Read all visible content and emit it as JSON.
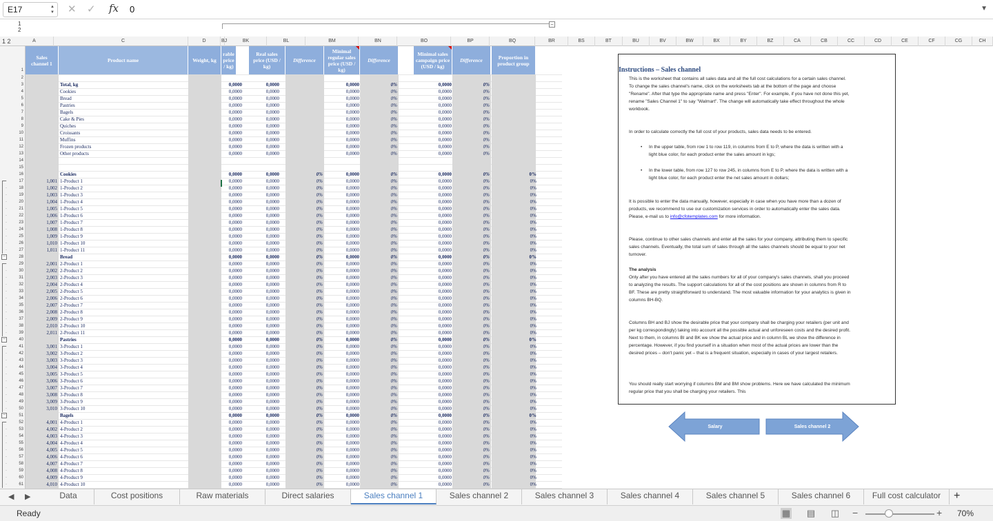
{
  "formula_bar": {
    "cell_ref": "E17",
    "value": "0",
    "fx": "fx",
    "cancel": "✕",
    "ok": "✓",
    "expand": "▼"
  },
  "grouping": {
    "levels": [
      "1",
      "2"
    ],
    "col_levels": "1 2",
    "minus": "−"
  },
  "col_headers": [
    [
      "A",
      22,
      56
    ],
    [
      "C",
      85,
      188
    ],
    [
      "D",
      273,
      47
    ],
    [
      "BJ",
      321,
      5
    ],
    [
      "BK",
      327,
      60
    ],
    [
      "BL",
      388,
      55
    ],
    [
      "BM",
      444,
      76
    ],
    [
      "BN",
      521,
      55
    ],
    [
      "BO",
      577,
      77
    ],
    [
      "BP",
      655,
      55
    ],
    [
      "BQ",
      711,
      65
    ],
    [
      "BR",
      777,
      47
    ],
    [
      "BS",
      824,
      39
    ],
    [
      "BT",
      863,
      40
    ],
    [
      "BU",
      903,
      39
    ],
    [
      "BV",
      942,
      39
    ],
    [
      "BW",
      981,
      39
    ],
    [
      "BX",
      1020,
      39
    ],
    [
      "BY",
      1059,
      39
    ],
    [
      "BZ",
      1098,
      39
    ],
    [
      "CA",
      1137,
      39
    ],
    [
      "CB",
      1176,
      39
    ],
    [
      "CC",
      1215,
      39
    ],
    [
      "CD",
      1254,
      39
    ],
    [
      "CE",
      1293,
      39
    ],
    [
      "CF",
      1332,
      39
    ],
    [
      "CG",
      1371,
      39
    ],
    [
      "CH",
      1410,
      30
    ]
  ],
  "table_headers": {
    "sales_channel": "Sales channel 1",
    "product_name": "Product name",
    "weight": "Weight, kg",
    "table_price": "rable price / kg)",
    "real_sales_price": "Real sales price (USD / kg)",
    "difference": "Difference",
    "min_regular": "Minimal regular sales price (USD / kg)",
    "difference2": "Difference",
    "min_campaign": "Minimal sales campaign price (USD / kg)",
    "difference3": "Difference",
    "proportion": "Proportion in product group"
  },
  "zero_val": "0,0000",
  "zero_pct": "0%",
  "totals": {
    "title": "Total, kg",
    "items": [
      "Cookies",
      "Bread",
      "Pastries",
      "Bagels",
      "Cake & Pies",
      "Quiches",
      "Croissants",
      "Muffins",
      "Frozen products",
      "Other products"
    ]
  },
  "groups": [
    {
      "name": "Cookies",
      "items": [
        [
          "1,001",
          "1-Product 1"
        ],
        [
          "1,002",
          "1-Product 2"
        ],
        [
          "1,003",
          "1-Product 3"
        ],
        [
          "1,004",
          "1-Product 4"
        ],
        [
          "1,005",
          "1-Product 5"
        ],
        [
          "1,006",
          "1-Product 6"
        ],
        [
          "1,007",
          "1-Product 7"
        ],
        [
          "1,008",
          "1-Product 8"
        ],
        [
          "1,009",
          "1-Product 9"
        ],
        [
          "1,010",
          "1-Product 10"
        ],
        [
          "1,011",
          "1-Product 11"
        ]
      ]
    },
    {
      "name": "Bread",
      "items": [
        [
          "2,001",
          "2-Product 1"
        ],
        [
          "2,002",
          "2-Product 2"
        ],
        [
          "2,003",
          "2-Product 3"
        ],
        [
          "2,004",
          "2-Product 4"
        ],
        [
          "2,005",
          "2-Product 5"
        ],
        [
          "2,006",
          "2-Product 6"
        ],
        [
          "2,007",
          "2-Product 7"
        ],
        [
          "2,008",
          "2-Product 8"
        ],
        [
          "2,009",
          "2-Product 9"
        ],
        [
          "2,010",
          "2-Product 10"
        ],
        [
          "2,011",
          "2-Product 11"
        ]
      ]
    },
    {
      "name": "Pastries",
      "items": [
        [
          "3,001",
          "3-Product 1"
        ],
        [
          "3,002",
          "3-Product 2"
        ],
        [
          "3,003",
          "3-Product 3"
        ],
        [
          "3,004",
          "3-Product 4"
        ],
        [
          "3,005",
          "3-Product 5"
        ],
        [
          "3,006",
          "3-Product 6"
        ],
        [
          "3,007",
          "3-Product 7"
        ],
        [
          "3,008",
          "3-Product 8"
        ],
        [
          "3,009",
          "3-Product 9"
        ],
        [
          "3,010",
          "3-Product 10"
        ]
      ]
    },
    {
      "name": "Bagels",
      "items": [
        [
          "4,001",
          "4-Product 1"
        ],
        [
          "4,002",
          "4-Product 2"
        ],
        [
          "4,003",
          "4-Product 3"
        ],
        [
          "4,004",
          "4-Product 4"
        ],
        [
          "4,005",
          "4-Product 5"
        ],
        [
          "4,006",
          "4-Product 6"
        ],
        [
          "4,007",
          "4-Product 7"
        ],
        [
          "4,008",
          "4-Product 8"
        ],
        [
          "4,009",
          "4-Product 9"
        ],
        [
          "4,010",
          "4-Product 10"
        ]
      ]
    }
  ],
  "instructions": {
    "title": "Instructions – Sales channel",
    "p1": "This is the worksheet that contains all sales data and all the full cost calculations for a certain sales channel. To change the sales channel's name, click on the worksheets tab at the bottom of the page and choose \"Rename\". After that type the appropriate name and press \"Enter\". For example, if you have not done this yet, rename \"Sales Channel 1\" to say \"Walmart\". The change will automatically take effect throughout the whole workbook.",
    "p2": "In order to calculate correctly the full cost of your products, sales data needs to be entered.",
    "b1": "In the upper table, from row 1 to row 119, in columns from E to P, where the data is written with a light blue color, for each product enter the sales amount in kgs;",
    "b2": "In the lower table, from row 127 to row 245, in columns from E to P, where the data is written with a light blue color, for each product enter the net sales amount in dollars;",
    "p3a": "It is possible to enter the data manually, however, especially in case when you have more than a dozen of products, we recommend to use our customization services in order to automatically enter the sales data. Please, e-mail us to",
    "email": "info@cfotemplates.com",
    "p3b": "for more information.",
    "p4": "Please, continue to other sales channels and enter all the sales for your company, attributing them to specific sales channels. Eventually, the total sum of sales through all the sales channels should be equal to your net turnover.",
    "analysis_title": "The analysis",
    "p5": "Only after you have entered all the sales numbers for all of your company's sales channels, shall you proceed to analyzing the results. The support calculations for all of the cost positions are shown in columns from R to BF. These are pretty straightforward to understand. The most valuable information for your analytics is given in columns BH-BQ.",
    "p6": "Columns BH and BJ show the desirable price that your company shall be charging your retailers (per unit and per kg correspondingly) taking into account all the possible actual and unforeseen costs and the desired profit. Next to them, in columns BI and BK we show the actual price and in column BL we show the difference in percentage. However, if you find yourself in a situation when most of the actual prices are lower than the desired prices – don't panic yet – that is a frequent situation, especially in cases of your largest retailers.",
    "p7": "You should really start worrying if columns BM and BM show problems. Here we have calculated the minimum regular price that you shall be charging your retailers. This"
  },
  "nav": {
    "prev": "Salary",
    "next": "Sales channel 2"
  },
  "tabs": [
    "Data",
    "Cost positions",
    "Raw materials",
    "Direct salaries",
    "Sales channel 1",
    "Sales channel 2",
    "Sales channel 3",
    "Sales channel 4",
    "Sales channel 5",
    "Sales channel 6",
    "Full cost calculator"
  ],
  "active_tab": "Sales channel 1",
  "tab_nav": {
    "prev": "◀",
    "next": "▶",
    "add": "+"
  },
  "status": {
    "ready": "Ready",
    "zoom": "70%",
    "minus": "−",
    "plus": "+"
  },
  "colors": {
    "header_blue": "#8eaedc",
    "arrow_blue": "#7da3d6",
    "active_tab": "#4a7ebf",
    "excel_green": "#1f7246"
  }
}
